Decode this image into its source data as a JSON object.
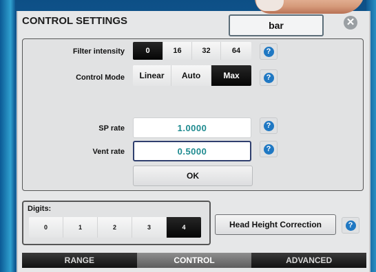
{
  "dialog": {
    "title": "CONTROL SETTINGS",
    "top_button": "bar",
    "close_glyph": "✕"
  },
  "filter": {
    "label": "Filter intensity",
    "options": [
      "0",
      "16",
      "32",
      "64"
    ],
    "selected": "0"
  },
  "control_mode": {
    "label": "Control Mode",
    "options": [
      "Linear",
      "Auto",
      "Max"
    ],
    "selected": "Max"
  },
  "sp_rate": {
    "label": "SP rate",
    "value": "1.0000"
  },
  "vent_rate": {
    "label": "Vent rate",
    "value": "0.5000"
  },
  "ok_label": "OK",
  "help_glyph": "?",
  "digits": {
    "label": "Digits:",
    "options": [
      "0",
      "1",
      "2",
      "3",
      "4"
    ],
    "selected": "4"
  },
  "head_height_label": "Head Height Correction",
  "tabs": [
    "RANGE",
    "CONTROL",
    "ADVANCED"
  ],
  "active_tab": "CONTROL",
  "colors": {
    "accent_blue": "#1f78c3",
    "value_teal": "#1d8a8f",
    "selected_black": "#050505"
  }
}
